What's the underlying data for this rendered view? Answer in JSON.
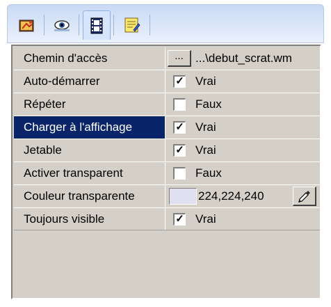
{
  "tabs": [
    {
      "icon": "properties-hand-icon",
      "active": false
    },
    {
      "icon": "eye-icon",
      "active": false
    },
    {
      "icon": "film-strip-icon",
      "active": true
    },
    {
      "icon": "notepad-icon",
      "active": false
    }
  ],
  "properties": [
    {
      "name": "Chemin d'accès",
      "type": "path",
      "button_label": "...",
      "value": "...\\debut_scrat.wm"
    },
    {
      "name": "Auto-démarrer",
      "type": "bool",
      "checked": true,
      "value": "Vrai"
    },
    {
      "name": "Répéter",
      "type": "bool",
      "checked": false,
      "value": "Faux"
    },
    {
      "name": "Charger à l'affichage",
      "type": "bool",
      "checked": true,
      "value": "Vrai",
      "selected": true
    },
    {
      "name": "Jetable",
      "type": "bool",
      "checked": true,
      "value": "Vrai"
    },
    {
      "name": "Activer transparent",
      "type": "bool",
      "checked": false,
      "value": "Faux"
    },
    {
      "name": "Couleur transparente",
      "type": "color",
      "value": "224,224,240",
      "swatch_color": "#e0e0f0"
    },
    {
      "name": "Toujours visible",
      "type": "bool",
      "checked": true,
      "value": "Vrai"
    }
  ],
  "colors": {
    "selection": "#0a246a",
    "panel_bg": "#d4d0c8"
  }
}
